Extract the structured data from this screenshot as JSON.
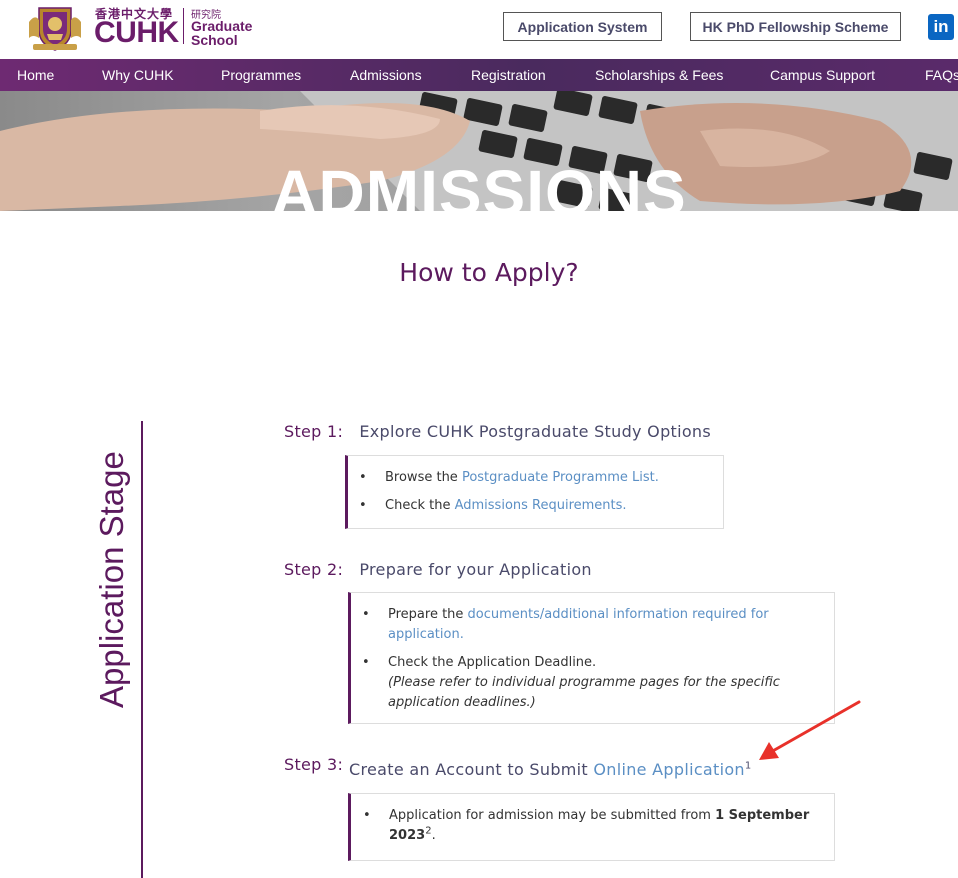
{
  "header": {
    "logo_cn": "香港中文大學",
    "logo_cuhk": "CUHK",
    "logo_gs_cn": "研究院",
    "logo_gs_line1": "Graduate",
    "logo_gs_line2": "School",
    "buttons": {
      "application_system": "Application System",
      "phd_fellowship": "HK PhD Fellowship Scheme"
    },
    "linkedin_label": "in"
  },
  "nav": {
    "items": [
      "Home",
      "Why CUHK",
      "Programmes",
      "Admissions",
      "Registration",
      "Scholarships & Fees",
      "Campus Support",
      "FAQs"
    ]
  },
  "hero": {
    "title": "ADMISSIONS"
  },
  "main": {
    "page_title": "How to Apply?",
    "stage_label": "Application Stage",
    "steps": [
      {
        "number": "Step 1:",
        "title": "Explore CUHK Postgraduate Study Options",
        "bullets": [
          {
            "prefix": "Browse the ",
            "link": "Postgraduate Programme List."
          },
          {
            "prefix": "Check the ",
            "link": "Admissions Requirements."
          }
        ]
      },
      {
        "number": "Step 2:",
        "title": "Prepare for your Application",
        "bullets": [
          {
            "prefix": "Prepare the ",
            "link_line1": "documents/additional information required for",
            "link_line2": "application."
          },
          {
            "text": "Check the Application Deadline.",
            "note_line1": "(Please refer to individual programme pages for the specific",
            "note_line2": "application deadlines.)"
          }
        ]
      },
      {
        "number": "Step 3:",
        "title_prefix": "Create an Account to Submit ",
        "title_link": "Online Application",
        "title_sup": "1",
        "bullets": [
          {
            "text": "Application for admission may be submitted from ",
            "bold_line1": "1 September",
            "bold_line2": "2023",
            "sup": "2",
            "suffix": "."
          }
        ]
      }
    ]
  },
  "colors": {
    "brand_purple": "#5c1a5e",
    "nav_bg": "#4a2a5e",
    "link_blue": "#5b8fc4",
    "annotation_arrow": "#e8312a"
  }
}
